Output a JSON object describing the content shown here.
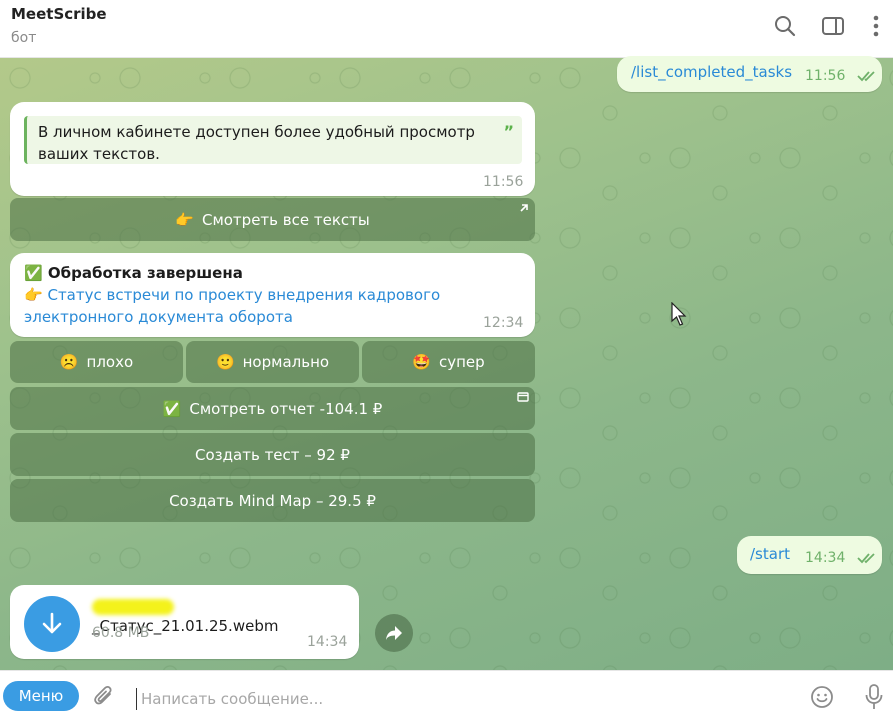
{
  "header": {
    "title": "MeetScribe",
    "subtitle": "бот"
  },
  "messages": {
    "cmd1": {
      "text": "/list_completed_tasks",
      "time": "11:56"
    },
    "info": {
      "quote": "В личном кабинете доступен более удобный просмотр ваших текстов.",
      "quote_mark": "”",
      "time": "11:56"
    },
    "done": {
      "title": "Обработка завершена",
      "title_emoji": "✅",
      "link_emoji": "👉",
      "link_line1": "Статус встречи по проекту внедрения кадрового",
      "link_line2": "электронного документа оборота",
      "time": "12:34"
    },
    "cmd2": {
      "text": "/start",
      "time": "14:34"
    },
    "file": {
      "name_suffix": "_Статус_21.01.25.webm",
      "size": "60.8 MB",
      "time": "14:34"
    }
  },
  "buttons": {
    "view_all": {
      "emoji": "👉",
      "label": "Смотреть все тексты"
    },
    "bad": {
      "emoji": "☹️",
      "label": "плохо"
    },
    "normal": {
      "emoji": "🙂",
      "label": "нормально"
    },
    "super": {
      "emoji": "🤩",
      "label": "супер"
    },
    "report": {
      "emoji": "✅",
      "label": "Смотреть отчет  -104.1 ₽"
    },
    "test": {
      "label": "Создать тест – 92 ₽"
    },
    "mindmap": {
      "label": "Создать Mind Map – 29.5 ₽"
    }
  },
  "bottom": {
    "menu_label": "Меню",
    "placeholder": "Написать сообщение..."
  },
  "colors": {
    "accent": "#3a9ce3",
    "link": "#2a8ad6",
    "check": "#6fb16a"
  }
}
